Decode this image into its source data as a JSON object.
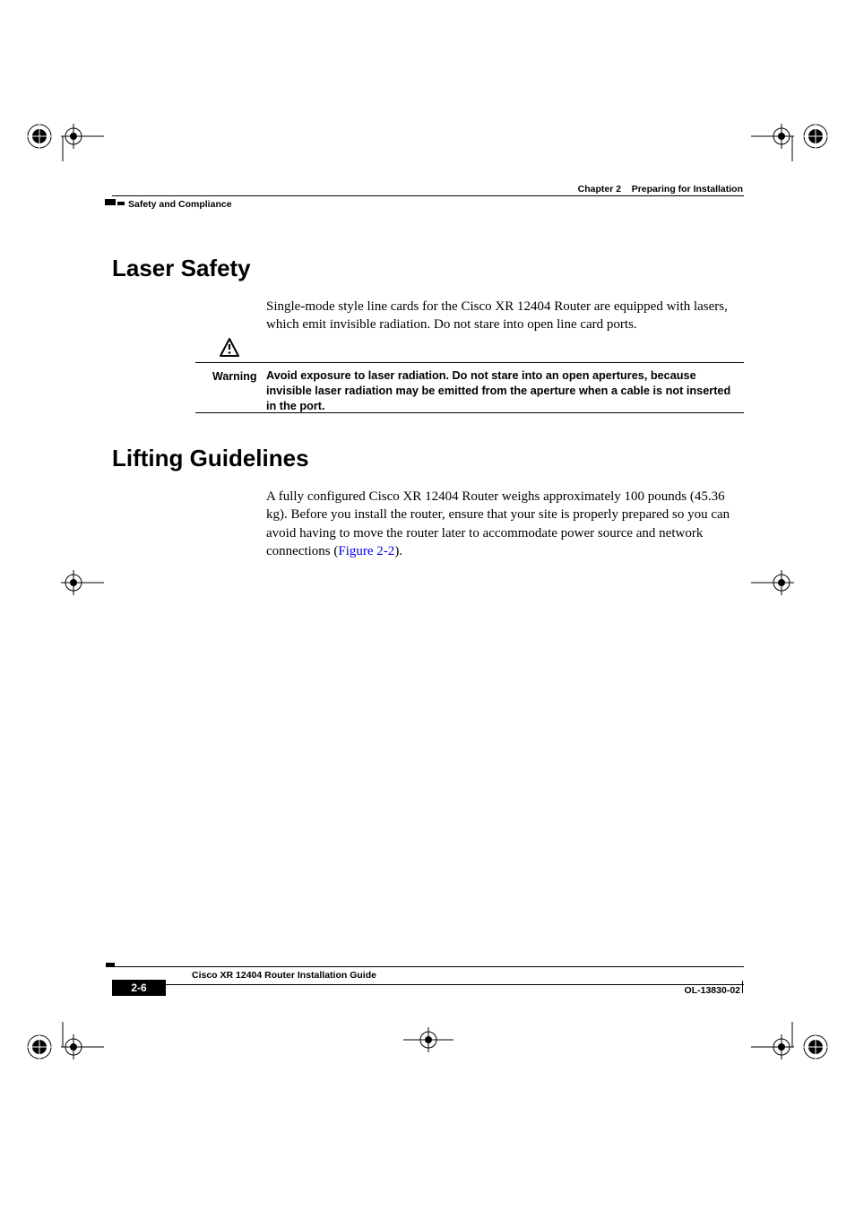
{
  "header": {
    "chapter_label": "Chapter 2",
    "chapter_title": "Preparing for Installation",
    "section_path": "Safety and Compliance"
  },
  "sections": {
    "laser_safety": {
      "title": "Laser Safety",
      "body": "Single-mode style line cards for the Cisco XR 12404 Router are equipped with lasers, which emit invisible radiation. Do not stare into open line card ports."
    },
    "warning": {
      "label": "Warning",
      "text": "Avoid exposure to laser radiation. Do not stare into an open apertures, because invisible laser radiation may be emitted from the aperture when a cable is not inserted in the port."
    },
    "lifting": {
      "title": "Lifting Guidelines",
      "body_pre": "A fully configured Cisco XR 12404 Router weighs approximately 100 pounds (45.36 kg). Before you install the router, ensure that your site is properly prepared so you can avoid having to move the router later to accommodate power source and network connections (",
      "figure_ref": "Figure 2-2",
      "body_post": ")."
    }
  },
  "footer": {
    "guide_title": "Cisco XR 12404 Router Installation Guide",
    "page_number": "2-6",
    "doc_number": "OL-13830-02"
  }
}
